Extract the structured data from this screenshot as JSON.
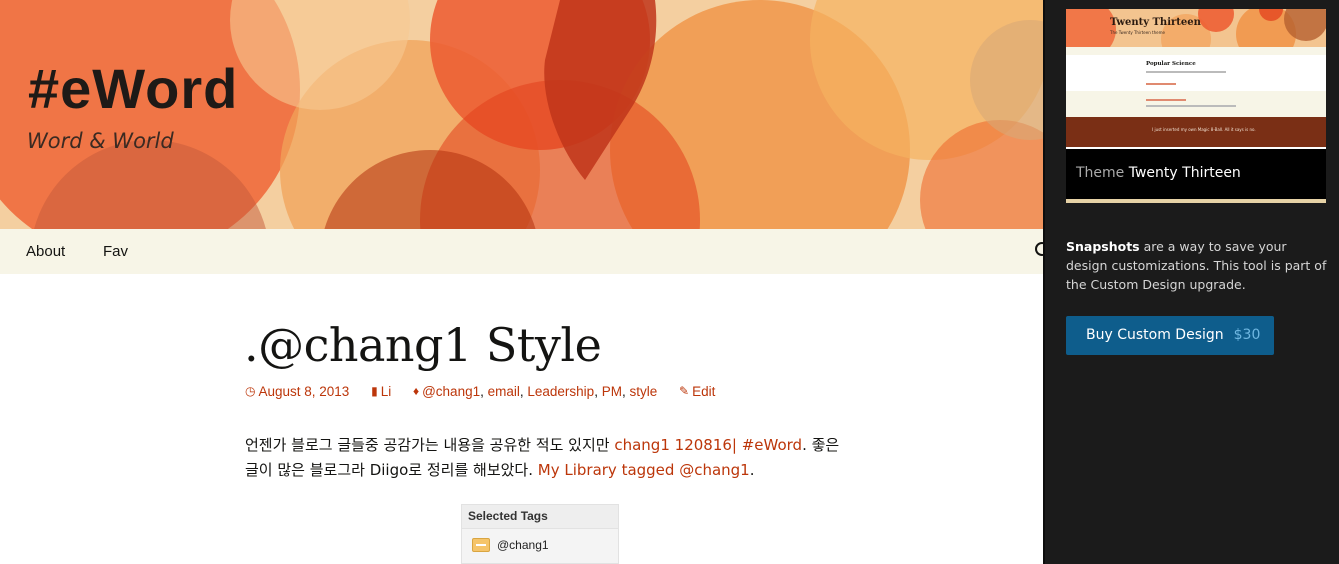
{
  "site": {
    "title": "#eWord",
    "description": "Word & World"
  },
  "nav": {
    "items": [
      "About",
      "Fav"
    ]
  },
  "post": {
    "title": ".@chang1 Style",
    "date": "August 8, 2013",
    "category": "Li",
    "tags": [
      "@chang1",
      "email",
      "Leadership",
      "PM",
      "style"
    ],
    "edit_label": "Edit",
    "body_text_1": "언젠가 블로그 글들중 공감가는 내용을 공유한 적도 있지만 ",
    "body_link_1": "chang1 120816| #eWord",
    "body_text_2": ". 좋은 글이 많은 블로그라  Diigo로 정리를 해보았다. ",
    "body_link_2": "My Library tagged @chang1",
    "body_text_3": "."
  },
  "tag_widget": {
    "header": "Selected Tags",
    "tag": "@chang1"
  },
  "panel": {
    "theme_label": "Theme",
    "theme_name": "Twenty Thirteen",
    "thumb_title": "Twenty Thirteen",
    "thumb_tagline": "The Twenty Thirteen theme",
    "thumb_post1": "Popular Science",
    "thumb_quote": "I just inserted my own Magic 8-Ball. All it says is no.",
    "snapshots_bold": "Snapshots",
    "snapshots_text": " are a way to save your design customizations. This tool is part of the Custom Design upgrade.",
    "buy_label": "Buy Custom Design",
    "buy_price": "$30"
  },
  "colors": {
    "accent": "#bc360a",
    "panel_bg": "#1b1b1b",
    "button": "#0e5d8c",
    "nav_bg": "#f7f5e7"
  }
}
